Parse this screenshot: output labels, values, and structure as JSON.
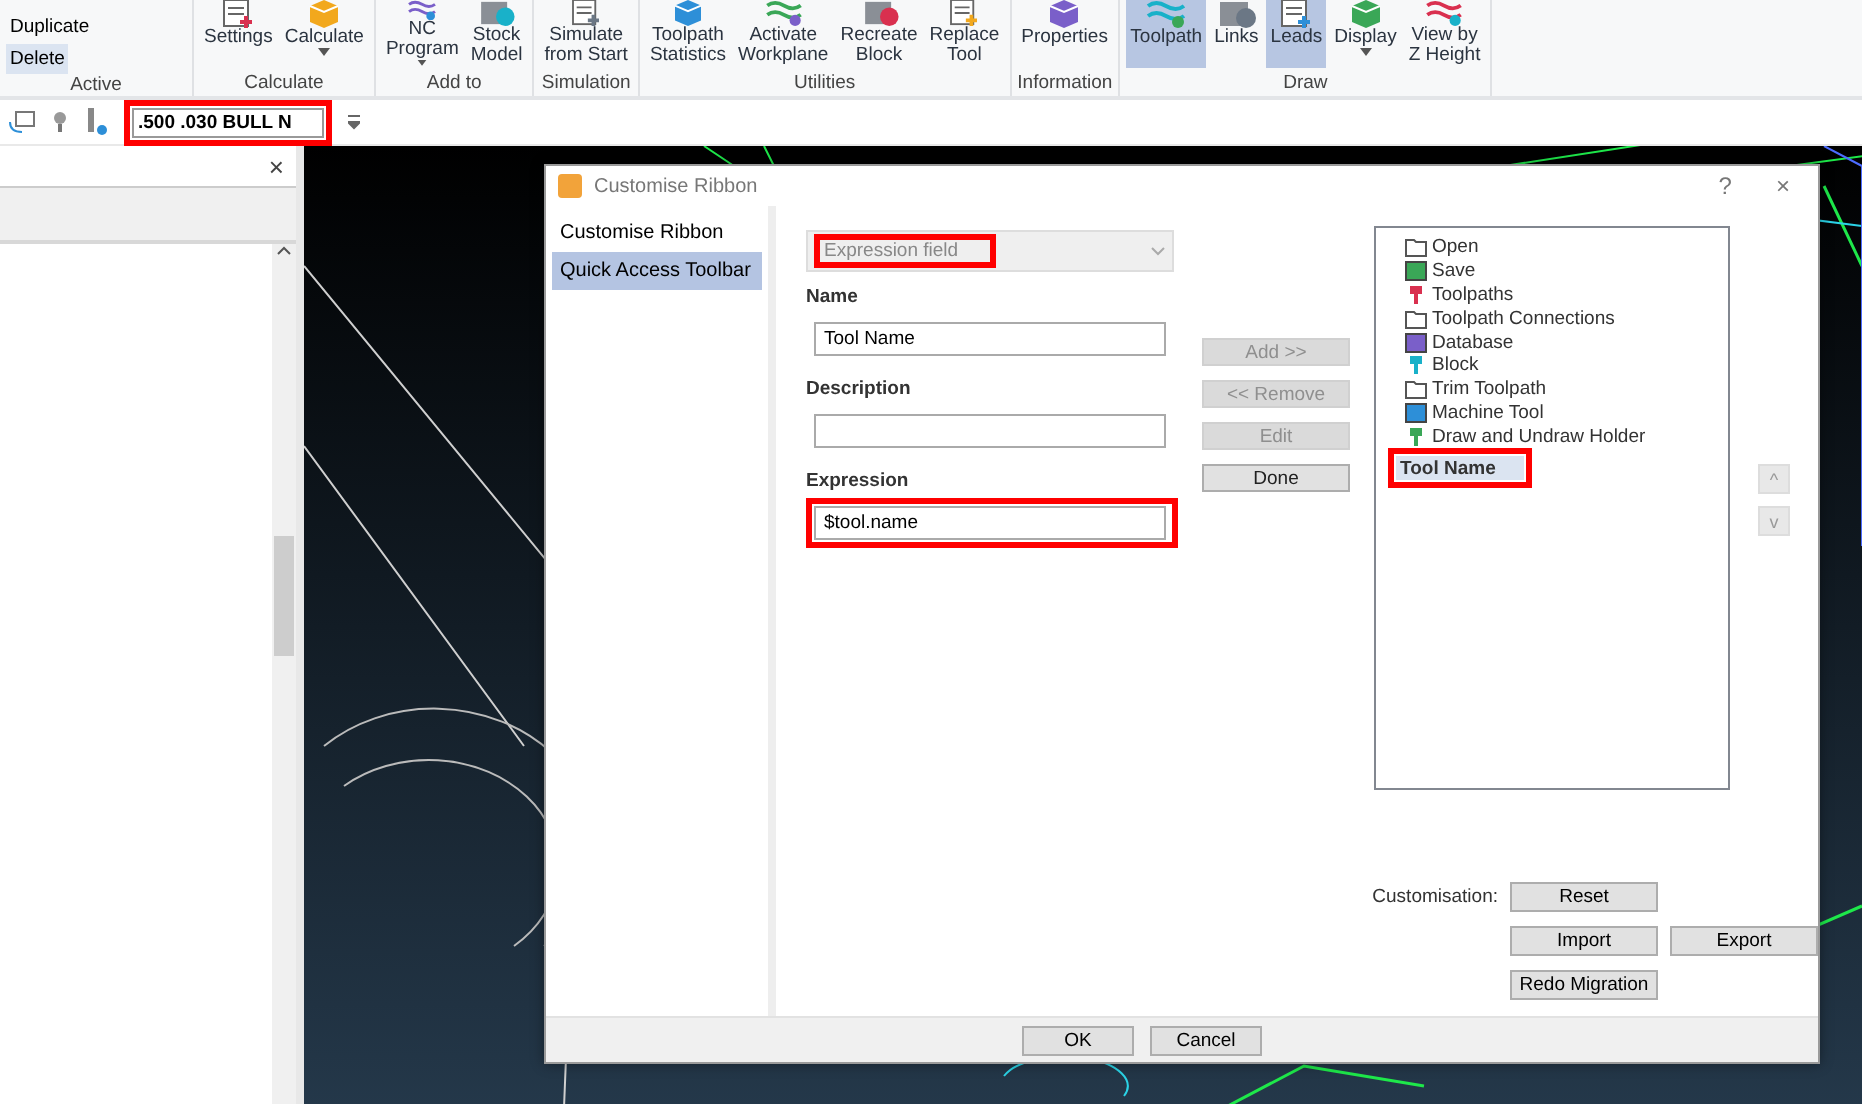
{
  "ribbon": {
    "groups": [
      {
        "label": "Active",
        "buttons": [
          {
            "kind": "small",
            "label_lines": [
              "Duplicate"
            ],
            "selected": false
          },
          {
            "kind": "small",
            "label_lines": [
              "Delete"
            ],
            "selected": true
          }
        ]
      },
      {
        "label": "Calculate",
        "buttons": [
          {
            "kind": "large",
            "label_lines": [
              "Settings"
            ],
            "selected": false,
            "dropdown": false
          },
          {
            "kind": "large",
            "label_lines": [
              "Calculate"
            ],
            "selected": false,
            "dropdown": true
          }
        ]
      },
      {
        "label": "Add to",
        "buttons": [
          {
            "kind": "large",
            "label_lines": [
              "NC",
              "Program"
            ],
            "selected": false,
            "dropdown": true
          },
          {
            "kind": "large",
            "label_lines": [
              "Stock",
              "Model"
            ],
            "selected": false,
            "dropdown": false
          }
        ]
      },
      {
        "label": "Simulation",
        "buttons": [
          {
            "kind": "large",
            "label_lines": [
              "Simulate",
              "from Start"
            ],
            "selected": false,
            "dropdown": false
          }
        ]
      },
      {
        "label": "Utilities",
        "buttons": [
          {
            "kind": "large",
            "label_lines": [
              "Toolpath",
              "Statistics"
            ],
            "selected": false,
            "dropdown": false
          },
          {
            "kind": "large",
            "label_lines": [
              "Activate",
              "Workplane"
            ],
            "selected": false,
            "dropdown": false
          },
          {
            "kind": "large",
            "label_lines": [
              "Recreate",
              "Block"
            ],
            "selected": false,
            "dropdown": false
          },
          {
            "kind": "large",
            "label_lines": [
              "Replace",
              "Tool"
            ],
            "selected": false,
            "dropdown": false
          }
        ]
      },
      {
        "label": "Information",
        "buttons": [
          {
            "kind": "large",
            "label_lines": [
              "Properties"
            ],
            "selected": false,
            "dropdown": false
          }
        ]
      },
      {
        "label": "Draw",
        "buttons": [
          {
            "kind": "large",
            "label_lines": [
              "Toolpath"
            ],
            "selected": true,
            "dropdown": false
          },
          {
            "kind": "large",
            "label_lines": [
              "Links"
            ],
            "selected": false,
            "dropdown": false
          },
          {
            "kind": "large",
            "label_lines": [
              "Leads"
            ],
            "selected": true,
            "dropdown": false
          },
          {
            "kind": "large",
            "label_lines": [
              "Display"
            ],
            "selected": false,
            "dropdown": true
          },
          {
            "kind": "large",
            "label_lines": [
              "View by",
              "Z Height"
            ],
            "selected": false,
            "dropdown": false
          }
        ]
      }
    ]
  },
  "quick_access": {
    "tool_field": {
      "value": ".500 .030 BULL N",
      "highlighted": true
    }
  },
  "left_panel": {
    "close": "×"
  },
  "dialog": {
    "title": "Customise Ribbon",
    "help": "?",
    "close": "×",
    "nav": [
      {
        "label": "Customise Ribbon",
        "selected": false
      },
      {
        "label": "Quick Access Toolbar",
        "selected": true
      }
    ],
    "type_dropdown": {
      "placeholder": "Expression field",
      "disabled": true,
      "highlighted": true
    },
    "fields": [
      {
        "label": "Name",
        "value": "Tool Name",
        "highlighted": false
      },
      {
        "label": "Description",
        "highlighted": false
      },
      {
        "label": "Expression",
        "value": "$tool.name",
        "highlighted": true
      }
    ],
    "actions": [
      {
        "label": "Add >>",
        "disabled": true
      },
      {
        "label": "<< Remove",
        "disabled": true
      },
      {
        "label": "Edit",
        "disabled": true
      },
      {
        "label": "Done",
        "disabled": false
      }
    ],
    "commands": [
      {
        "kind": "command",
        "label": "Open",
        "selected": false,
        "highlighted": false
      },
      {
        "kind": "command",
        "label": "Save",
        "selected": false,
        "highlighted": false
      },
      {
        "kind": "command",
        "label": "Toolpaths",
        "selected": false,
        "highlighted": false
      },
      {
        "kind": "command",
        "label": "Toolpath Connections",
        "selected": false,
        "highlighted": false
      },
      {
        "kind": "command",
        "label": "Database",
        "selected": false,
        "highlighted": false
      },
      {
        "kind": "command",
        "label": "Block",
        "selected": false,
        "highlighted": false
      },
      {
        "kind": "command",
        "label": "Trim Toolpath",
        "selected": false,
        "highlighted": false
      },
      {
        "kind": "command",
        "label": "Machine Tool",
        "selected": false,
        "highlighted": false
      },
      {
        "kind": "command",
        "label": "Draw and Undraw Holder",
        "selected": false,
        "highlighted": false
      },
      {
        "kind": "expression",
        "label": "Tool Name",
        "selected": true,
        "highlighted": true
      }
    ],
    "move": [
      "^",
      "v"
    ],
    "customisation": {
      "label": "Customisation:",
      "buttons": [
        "Reset",
        "Import",
        "Export",
        "Redo Migration"
      ]
    },
    "footer": [
      "OK",
      "Cancel"
    ]
  }
}
